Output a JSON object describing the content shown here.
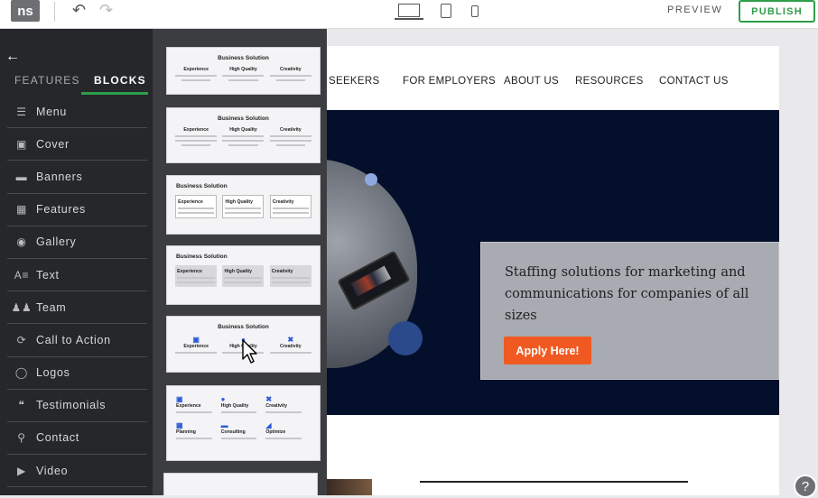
{
  "topbar": {
    "logo": "ns",
    "undo": "↶",
    "redo": "↷",
    "preview": "PREVIEW",
    "publish": "PUBLISH"
  },
  "sidebar": {
    "tabs": {
      "features": "FEATURES",
      "blocks": "BLOCKS"
    },
    "categories": [
      {
        "label": "Menu",
        "icon": "menu-icon"
      },
      {
        "label": "Cover",
        "icon": "cover-icon"
      },
      {
        "label": "Banners",
        "icon": "banners-icon"
      },
      {
        "label": "Features",
        "icon": "features-grid-icon"
      },
      {
        "label": "Gallery",
        "icon": "camera-icon"
      },
      {
        "label": "Text",
        "icon": "text-icon"
      },
      {
        "label": "Team",
        "icon": "team-icon"
      },
      {
        "label": "Call to Action",
        "icon": "cta-icon"
      },
      {
        "label": "Logos",
        "icon": "logos-icon"
      },
      {
        "label": "Testimonials",
        "icon": "quote-icon"
      },
      {
        "label": "Contact",
        "icon": "location-pin-icon"
      },
      {
        "label": "Video",
        "icon": "video-icon"
      }
    ]
  },
  "thumbs": {
    "title": "Business Solution",
    "cols": [
      "Experience",
      "High Quality",
      "Creativity"
    ],
    "grid": [
      "Experience",
      "High Quality",
      "Creativity",
      "Planning",
      "Consulting",
      "Optimize"
    ]
  },
  "canvas": {
    "nav": [
      "SEEKERS",
      "FOR EMPLOYERS",
      "ABOUT US",
      "RESOURCES",
      "CONTACT US"
    ],
    "headline": "Staffing solutions for marketing and communications for companies of all sizes",
    "cta": "Apply Here!"
  },
  "help": "?",
  "colors": {
    "accent_green": "#2e9e4a",
    "cta_orange": "#f05a22",
    "hero_navy": "#04102b"
  }
}
